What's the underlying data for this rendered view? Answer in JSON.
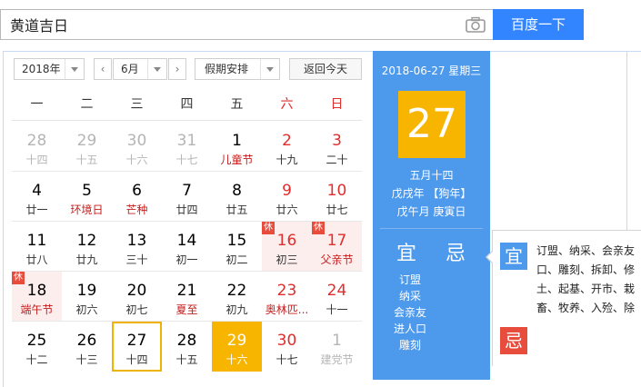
{
  "search": {
    "value": "黄道吉日",
    "button": "百度一下",
    "icon": "camera-icon"
  },
  "controls": {
    "year": "2018年",
    "prev": "‹",
    "month": "6月",
    "next": "›",
    "holiday": "假期安排",
    "today": "返回今天"
  },
  "weekdays": [
    "一",
    "二",
    "三",
    "四",
    "五",
    "六",
    "日"
  ],
  "weeks": [
    [
      {
        "num": "28",
        "sub": "十四",
        "type": "other"
      },
      {
        "num": "29",
        "sub": "十五",
        "type": "other"
      },
      {
        "num": "30",
        "sub": "十六",
        "type": "other"
      },
      {
        "num": "31",
        "sub": "十七",
        "type": "other"
      },
      {
        "num": "1",
        "sub": "儿童节",
        "type": "fest"
      },
      {
        "num": "2",
        "sub": "十九",
        "type": "weekend"
      },
      {
        "num": "3",
        "sub": "二十",
        "type": "weekend"
      }
    ],
    [
      {
        "num": "4",
        "sub": "廿一",
        "type": ""
      },
      {
        "num": "5",
        "sub": "环境日",
        "type": "fest"
      },
      {
        "num": "6",
        "sub": "芒种",
        "type": "fest"
      },
      {
        "num": "7",
        "sub": "廿四",
        "type": ""
      },
      {
        "num": "8",
        "sub": "廿五",
        "type": ""
      },
      {
        "num": "9",
        "sub": "廿六",
        "type": "weekend"
      },
      {
        "num": "10",
        "sub": "廿七",
        "type": "weekend"
      }
    ],
    [
      {
        "num": "11",
        "sub": "廿八",
        "type": ""
      },
      {
        "num": "12",
        "sub": "廿九",
        "type": ""
      },
      {
        "num": "13",
        "sub": "三十",
        "type": ""
      },
      {
        "num": "14",
        "sub": "初一",
        "type": ""
      },
      {
        "num": "15",
        "sub": "初二",
        "type": ""
      },
      {
        "num": "16",
        "sub": "初三",
        "type": "weekend holiday",
        "badge": "休"
      },
      {
        "num": "17",
        "sub": "父亲节",
        "type": "weekend holiday fest",
        "badge": "休"
      }
    ],
    [
      {
        "num": "18",
        "sub": "端午节",
        "type": "holiday fest",
        "badge": "休"
      },
      {
        "num": "19",
        "sub": "初六",
        "type": ""
      },
      {
        "num": "20",
        "sub": "初七",
        "type": ""
      },
      {
        "num": "21",
        "sub": "夏至",
        "type": "fest"
      },
      {
        "num": "22",
        "sub": "初九",
        "type": ""
      },
      {
        "num": "23",
        "sub": "奥林匹...",
        "type": "weekend fest"
      },
      {
        "num": "24",
        "sub": "十一",
        "type": "weekend"
      }
    ],
    [
      {
        "num": "25",
        "sub": "十二",
        "type": ""
      },
      {
        "num": "26",
        "sub": "十三",
        "type": ""
      },
      {
        "num": "27",
        "sub": "十四",
        "type": "today"
      },
      {
        "num": "28",
        "sub": "十五",
        "type": ""
      },
      {
        "num": "29",
        "sub": "十六",
        "type": "selected"
      },
      {
        "num": "30",
        "sub": "十七",
        "type": "weekend"
      },
      {
        "num": "1",
        "sub": "建党节",
        "type": "other"
      }
    ]
  ],
  "panel": {
    "date_line": "2018-06-27 星期三",
    "day": "27",
    "lunar": "五月十四",
    "year_line": "戊戌年 【狗年】",
    "month_line": "戊午月 庚寅日",
    "yi_label": "宜",
    "ji_label": "忌",
    "yi_items": [
      "订盟",
      "纳采",
      "会亲友",
      "进人口",
      "雕刻"
    ]
  },
  "detail": {
    "yi_tag": "宜",
    "ji_tag": "忌",
    "good_lines": [
      "订盟、纳采、会亲友",
      "口、雕刻、拆卸、修",
      "土、起基、开市、栽",
      "畜、牧养、入殓、除"
    ]
  }
}
